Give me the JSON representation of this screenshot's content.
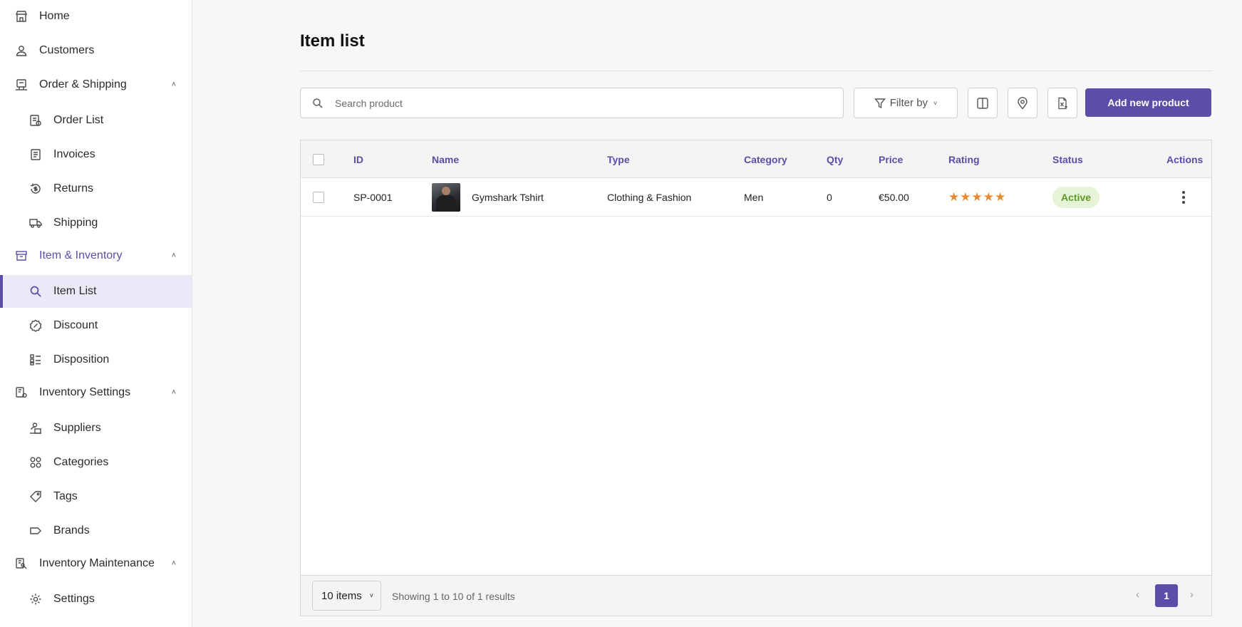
{
  "sidebar": {
    "home": "Home",
    "customers": "Customers",
    "order_shipping": "Order & Shipping",
    "order_list": "Order List",
    "invoices": "Invoices",
    "returns": "Returns",
    "shipping": "Shipping",
    "item_inventory": "Item & Inventory",
    "item_list": "Item List",
    "discount": "Discount",
    "disposition": "Disposition",
    "inventory_settings": "Inventory Settings",
    "suppliers": "Suppliers",
    "categories": "Categories",
    "tags": "Tags",
    "brands": "Brands",
    "inventory_maintenance": "Inventory Maintenance",
    "settings": "Settings"
  },
  "page": {
    "title": "Item list"
  },
  "toolbar": {
    "search_placeholder": "Search product",
    "filter_label": "Filter by",
    "add_label": "Add new product"
  },
  "table": {
    "headers": {
      "id": "ID",
      "name": "Name",
      "type": "Type",
      "category": "Category",
      "qty": "Qty",
      "price": "Price",
      "rating": "Rating",
      "status": "Status",
      "actions": "Actions"
    },
    "rows": [
      {
        "id": "SP-0001",
        "name": "Gymshark Tshirt",
        "type": "Clothing & Fashion",
        "category": "Men",
        "qty": "0",
        "price": "€50.00",
        "rating_stars": "★★★★★",
        "status": "Active"
      }
    ]
  },
  "footer": {
    "per_page": "10 items",
    "showing": "Showing 1 to 10 of 1 results",
    "current_page": "1"
  },
  "colors": {
    "accent": "#5a4ea8",
    "active_bg": "#ebe8f8",
    "star": "#e58a2f",
    "status_active_bg": "#e6f3d6",
    "status_active_text": "#5c9a2a"
  }
}
